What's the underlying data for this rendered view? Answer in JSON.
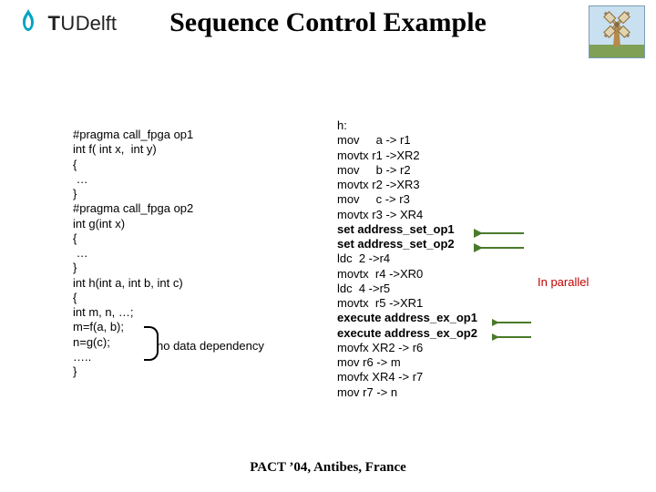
{
  "logo": {
    "text": "TUDelft"
  },
  "title": "Sequence Control Example",
  "left_code": [
    "#pragma call_fpga op1",
    "int f( int x,  int y)",
    "{",
    " …",
    "}",
    "#pragma call_fpga op2",
    "int g(int x)",
    "{",
    " …",
    "}",
    "int h(int a, int b, int c)",
    "{",
    "int m, n, …;",
    "m=f(a, b);",
    "n=g(c);",
    "…..",
    "}"
  ],
  "no_dependency_label": "no data dependency",
  "right_code": [
    {
      "t": "h:",
      "b": false
    },
    {
      "t": "mov     a -> r1",
      "b": false
    },
    {
      "t": "movtx r1 ->XR2",
      "b": false
    },
    {
      "t": "mov     b -> r2",
      "b": false
    },
    {
      "t": "movtx r2 ->XR3",
      "b": false
    },
    {
      "t": "mov     c -> r3",
      "b": false
    },
    {
      "t": "movtx r3 -> XR4",
      "b": false
    },
    {
      "t": "set address_set_op1",
      "b": true
    },
    {
      "t": "set address_set_op2",
      "b": true
    },
    {
      "t": "ldc  2 ->r4",
      "b": false
    },
    {
      "t": "movtx  r4 ->XR0",
      "b": false
    },
    {
      "t": "ldc  4 ->r5",
      "b": false
    },
    {
      "t": "movtx  r5 ->XR1",
      "b": false
    },
    {
      "t": "execute address_ex_op1",
      "b": true
    },
    {
      "t": "execute address_ex_op2",
      "b": true
    },
    {
      "t": "movfx XR2 -> r6",
      "b": false
    },
    {
      "t": "mov r6 -> m",
      "b": false
    },
    {
      "t": "movfx XR4 -> r7",
      "b": false
    },
    {
      "t": "mov r7 -> n",
      "b": false
    }
  ],
  "in_parallel_label": "In parallel",
  "footer": "PACT ’04, Antibes, France"
}
